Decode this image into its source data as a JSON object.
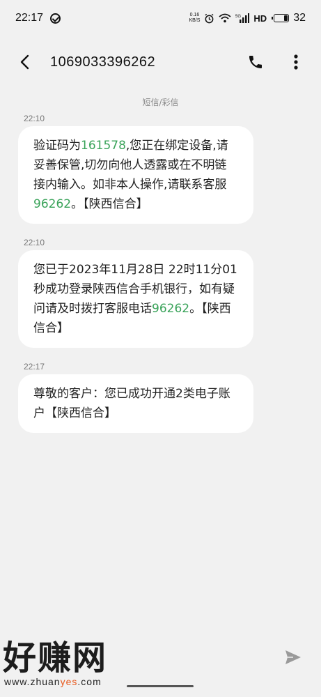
{
  "status_bar": {
    "time": "22:17",
    "net_speed_value": "0.16",
    "net_speed_unit": "KB/S",
    "signal_label": "5G",
    "hd_label": "HD",
    "battery_level": "32",
    "battery_fraction": 0.32
  },
  "header": {
    "title": "1069033396262",
    "back_icon": "back-arrow-icon",
    "call_icon": "phone-icon",
    "menu_icon": "more-vertical-icon"
  },
  "conversation": {
    "sms_type_label": "短信/彩信",
    "messages": [
      {
        "time": "22:10",
        "parts": [
          "验证码为",
          "161578",
          ",您正在绑定设备,请妥善保管,切勿向他人透露或在不明链接内输入。如非本人操作,请联系客服",
          "96262",
          "。【陕西信合】"
        ]
      },
      {
        "time": "22:10",
        "parts": [
          "您已于2023年11月28日 22时11分01秒成功登录陕西信合手机银行，如有疑问请及时拨打客服电话",
          "96262",
          "。【陕西信合】"
        ]
      },
      {
        "time": "22:17",
        "parts": [
          "尊敬的客户：您已成功开通2类电子账户【陕西信合】"
        ]
      }
    ]
  },
  "input_bar": {
    "placeholder": "",
    "send_icon": "send-icon"
  },
  "watermark": {
    "main_text": "好赚网",
    "url_prefix": "www.zhuan",
    "url_highlight": "yes",
    "url_suffix": ".com"
  },
  "colors": {
    "background": "#f1f1f1",
    "bubble": "#ffffff",
    "link_green": "#3aa35a",
    "watermark_orange": "#e8581c"
  }
}
